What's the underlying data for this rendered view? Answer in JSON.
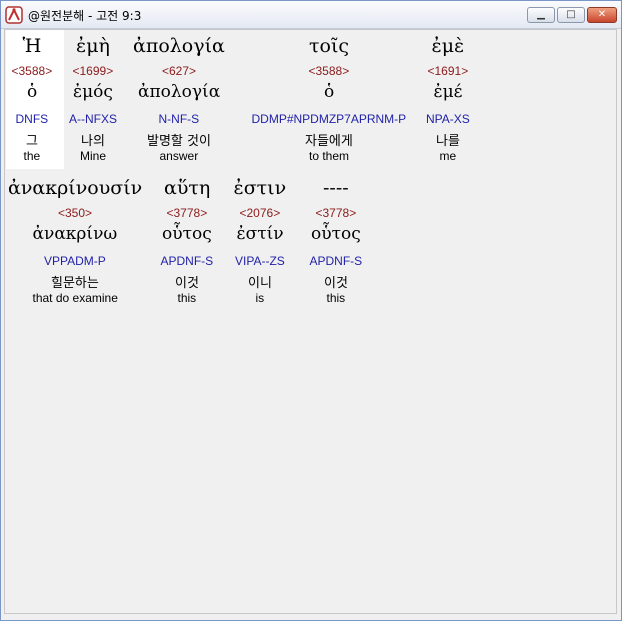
{
  "window": {
    "title": "@원전분해 - 고전 9:3",
    "minimize_glyph": "▁",
    "maximize_glyph": "□",
    "close_glyph": "✕",
    "app_icon": "compass-icon"
  },
  "words": [
    {
      "greek": "Ἡ",
      "strong": "<3588>",
      "lemma": "ὁ",
      "morph": "DNFS",
      "korean": "그",
      "english": "the"
    },
    {
      "greek": "ἐμὴ",
      "strong": "<1699>",
      "lemma": "ἐμός",
      "morph": "A--NFXS",
      "korean": "나의",
      "english": "Mine"
    },
    {
      "greek": "ἀπολογία",
      "strong": "<627>",
      "lemma": "ἀπολογία",
      "morph": "N-NF-S",
      "korean": "발명할 것이",
      "english": "answer"
    },
    {
      "greek": "τοῖς",
      "strong": "<3588>",
      "lemma": "ὁ",
      "morph": "DDMP#NPDMZP7APRNM-P",
      "korean": "자들에게",
      "english": "to them"
    },
    {
      "greek": "ἐμὲ",
      "strong": "<1691>",
      "lemma": "ἐμέ",
      "morph": "NPA-XS",
      "korean": "나를",
      "english": "me"
    },
    {
      "greek": "ἀνακρίνουσίν",
      "strong": "<350>",
      "lemma": "ἀνακρίνω",
      "morph": "VPPADM-P",
      "korean": "힐문하는",
      "english": "that do examine"
    },
    {
      "greek": "αὕτη",
      "strong": "<3778>",
      "lemma": "οὗτος",
      "morph": "APDNF-S",
      "korean": "이것",
      "english": "this"
    },
    {
      "greek": "ἐστιν",
      "strong": "<2076>",
      "lemma": "ἐστίν",
      "morph": "VIPA--ZS",
      "korean": "이니",
      "english": "is"
    },
    {
      "greek": "----",
      "strong": "<3778>",
      "lemma": "οὗτος",
      "morph": "APDNF-S",
      "korean": "이것",
      "english": "this"
    }
  ],
  "colors": {
    "strong": "#8b1a1a",
    "morph": "#1f1fa8",
    "highlight": "#ffffff"
  }
}
